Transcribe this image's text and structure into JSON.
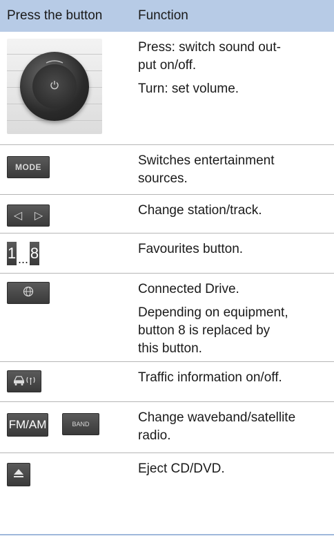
{
  "header": {
    "col1": "Press the button",
    "col2": "Function"
  },
  "rows": [
    {
      "texts": [
        "Press: switch sound out-put on/off.",
        "Turn: set volume."
      ],
      "line1a": "Press: switch sound out-",
      "line1b": "put on/off.",
      "line2": "Turn: set volume."
    },
    {
      "button_label": "MODE",
      "line1a": "Switches entertainment",
      "line1b": "sources."
    },
    {
      "left_arrow": "◁",
      "right_arrow": "▷",
      "line1": "Change station/track."
    },
    {
      "key_first": "1",
      "dots": "...",
      "key_last": "8",
      "line1": "Favourites button."
    },
    {
      "line1": "Connected Drive.",
      "line2a": "Depending on equipment,",
      "line2b": "button 8 is replaced by",
      "line2c": "this button."
    },
    {
      "line1": "Traffic information on/off."
    },
    {
      "fm_label": "FM/AM",
      "band_label": "BAND",
      "line1a": "Change waveband/satellite",
      "line1b": "radio."
    },
    {
      "line1": "Eject CD/DVD."
    }
  ],
  "colors": {
    "header_bg": "#b7cbe6",
    "button_dark": "#3a3a3a"
  },
  "icons": [
    "power-icon",
    "globe-icon",
    "traffic-radio-icon",
    "eject-icon"
  ]
}
